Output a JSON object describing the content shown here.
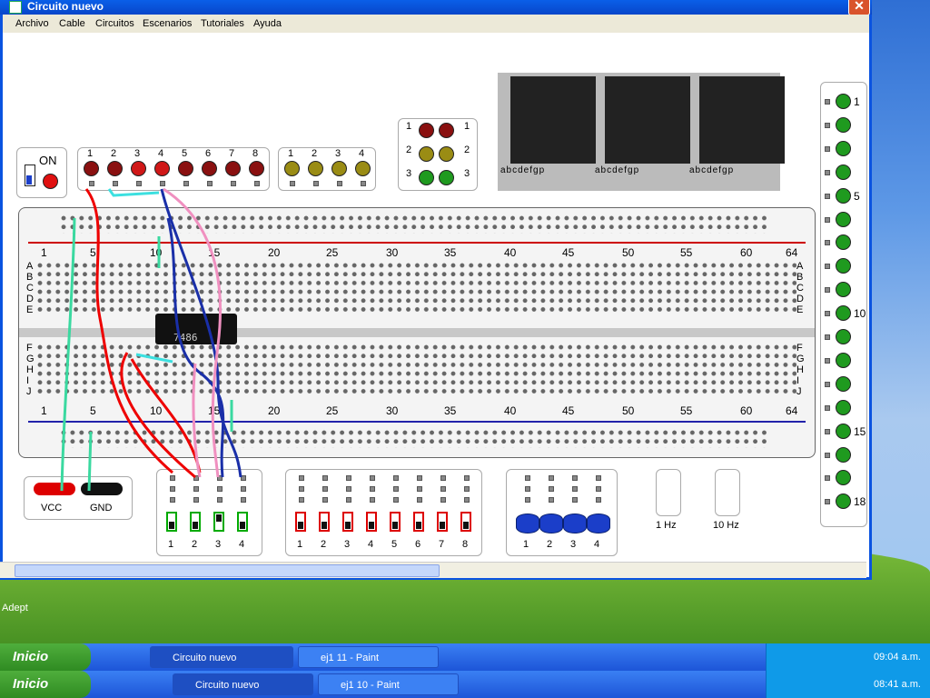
{
  "window": {
    "title": "Circuito nuevo",
    "close": "✕"
  },
  "menu": [
    "Archivo",
    "Cable",
    "Circuitos",
    "Escenarios",
    "Tutoriales",
    "Ayuda"
  ],
  "power": {
    "label": "ON"
  },
  "led_group_red": {
    "labels": [
      "1",
      "2",
      "3",
      "4",
      "5",
      "6",
      "7",
      "8"
    ],
    "colors": [
      "#8a1010",
      "#8a1010",
      "#d01818",
      "#d01818",
      "#8a1010",
      "#8a1010",
      "#8a1010",
      "#8a1010"
    ]
  },
  "led_group_yellow": {
    "labels": [
      "1",
      "2",
      "3",
      "4"
    ]
  },
  "traffic": {
    "left": [
      "1",
      "2",
      "3"
    ],
    "right": [
      "1",
      "2",
      "3"
    ]
  },
  "seven_seg": {
    "pins": "abcdefgp"
  },
  "breadboard": {
    "col_numbers": [
      "1",
      "5",
      "10",
      "15",
      "20",
      "25",
      "30",
      "35",
      "40",
      "45",
      "50",
      "55",
      "60",
      "64"
    ],
    "row_top": [
      "A",
      "B",
      "C",
      "D",
      "E"
    ],
    "row_bottom": [
      "F",
      "G",
      "H",
      "I",
      "J"
    ]
  },
  "chip": {
    "label": "7486"
  },
  "supply": {
    "vcc": "VCC",
    "gnd": "GND"
  },
  "input_switches_a": {
    "labels": [
      "1",
      "2",
      "3",
      "4"
    ]
  },
  "input_switches_b": {
    "labels": [
      "1",
      "2",
      "3",
      "4",
      "5",
      "6",
      "7",
      "8"
    ]
  },
  "push_buttons": {
    "labels": [
      "1",
      "2",
      "3",
      "4"
    ]
  },
  "clocks": {
    "one": "1 Hz",
    "ten": "10 Hz"
  },
  "right_leds": {
    "labels": [
      "1",
      "5",
      "10",
      "15",
      "18"
    ]
  },
  "taskbar_top": {
    "start": "Inicio",
    "items": [
      "Circuito nuevo",
      "ej1 11 - Paint"
    ],
    "time": "09:04 a.m."
  },
  "taskbar_bottom": {
    "start": "Inicio",
    "items": [
      "Circuito nuevo",
      "ej1 10 - Paint"
    ],
    "time": "08:41 a.m."
  },
  "desktop": {
    "icon_label": "Adept"
  }
}
